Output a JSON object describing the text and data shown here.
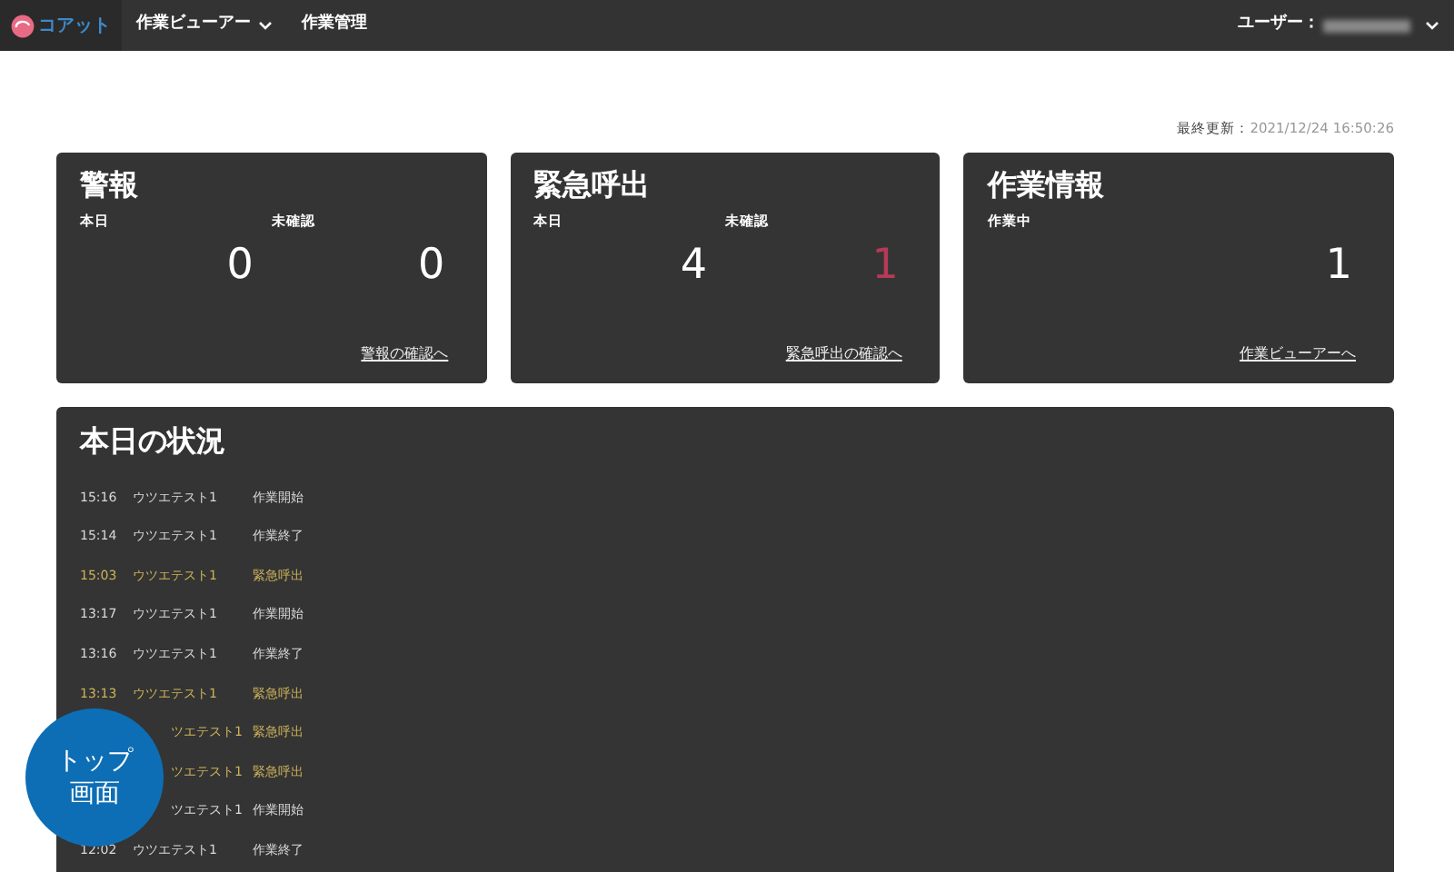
{
  "navbar": {
    "brand": "コアット",
    "menus": [
      {
        "label": "作業ビューアー",
        "dropdown": true
      },
      {
        "label": "作業管理",
        "dropdown": false
      }
    ],
    "user_label": "ユーザー："
  },
  "last_updated": {
    "label": "最終更新：",
    "value": "2021/12/24 16:50:26"
  },
  "cards": [
    {
      "title": "警報",
      "stats": [
        {
          "label": "本日",
          "value": "0",
          "alert": false
        },
        {
          "label": "未確認",
          "value": "0",
          "alert": false
        }
      ],
      "link": "警報の確認へ"
    },
    {
      "title": "緊急呼出",
      "stats": [
        {
          "label": "本日",
          "value": "4",
          "alert": false
        },
        {
          "label": "未確認",
          "value": "1",
          "alert": true
        }
      ],
      "link": "緊急呼出の確認へ"
    },
    {
      "title": "作業情報",
      "stats": [
        {
          "label": "作業中",
          "value": "1",
          "alert": false
        }
      ],
      "link": "作業ビューアーへ"
    }
  ],
  "status": {
    "title": "本日の状況",
    "events": [
      {
        "time": "15:16",
        "name": "ウツエテスト1",
        "event": "作業開始",
        "color": "#d9d9d9"
      },
      {
        "time": "15:14",
        "name": "ウツエテスト1",
        "event": "作業終了",
        "color": "#d9d9d9"
      },
      {
        "time": "15:03",
        "name": "ウツエテスト1",
        "event": "緊急呼出",
        "color": "#cdb25a"
      },
      {
        "time": "13:17",
        "name": "ウツエテスト1",
        "event": "作業開始",
        "color": "#d9d9d9"
      },
      {
        "time": "13:16",
        "name": "ウツエテスト1",
        "event": "作業終了",
        "color": "#d9d9d9"
      },
      {
        "time": "13:13",
        "name": "ウツエテスト1",
        "event": "緊急呼出",
        "color": "#cdb25a"
      },
      {
        "name": "ツエテスト1",
        "event": "緊急呼出",
        "color": "#cdb25a"
      },
      {
        "name": "ツエテスト1",
        "event": "緊急呼出",
        "color": "#cdb25a"
      },
      {
        "name": "ツエテスト1",
        "event": "作業開始",
        "color": "#d9d9d9"
      },
      {
        "time": "12:02",
        "name": "ウツエテスト1",
        "event": "作業終了",
        "color": "#d9d9d9"
      }
    ]
  },
  "top_button": {
    "lines": [
      "トップ",
      "画面"
    ]
  }
}
